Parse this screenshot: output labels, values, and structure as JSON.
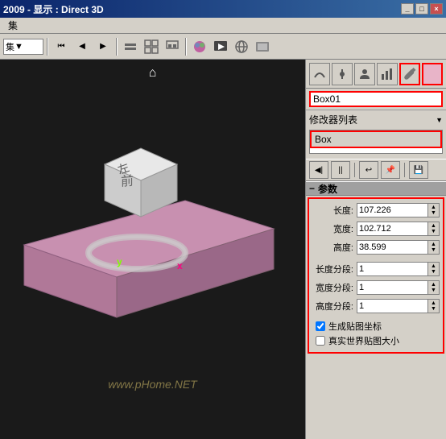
{
  "titlebar": {
    "text": "2009  -  显示 : Direct 3D",
    "buttons": [
      "_",
      "□",
      "×"
    ]
  },
  "menubar": {
    "items": [
      "集"
    ]
  },
  "toolbar": {
    "dropdown_value": "集",
    "buttons": [
      "◀▶",
      "◀",
      "▶",
      "layers",
      "grid",
      "snap",
      "colors",
      "render",
      "env",
      "preview"
    ]
  },
  "viewport": {
    "watermark": "www.pHome.NET",
    "y_label": "y",
    "x_label": "x"
  },
  "right_panel": {
    "toolbar_buttons": [
      "curve",
      "pin",
      "user",
      "graph",
      "wrench"
    ],
    "active_button_index": 4,
    "object_name": "Box01",
    "color_swatch": "#d4a0b8",
    "modifier_list_label": "修改器列表",
    "modifier_item": "Box",
    "panel2_buttons": [
      "◀|",
      "||",
      "↩",
      "pin2",
      "save"
    ],
    "params_header": "参数",
    "params": [
      {
        "label": "长度:",
        "value": "107.226"
      },
      {
        "label": "宽度:",
        "value": "102.712"
      },
      {
        "label": "高度:",
        "value": "38.599"
      },
      {
        "label": "长度分段:",
        "value": "1"
      },
      {
        "label": "宽度分段:",
        "value": "1"
      },
      {
        "label": "高度分段:",
        "value": "1"
      }
    ],
    "checkboxes": [
      {
        "label": "生成贴图坐标",
        "checked": true
      },
      {
        "label": "真实世界贴图大小",
        "checked": false
      }
    ],
    "collapse_icon": "−"
  }
}
